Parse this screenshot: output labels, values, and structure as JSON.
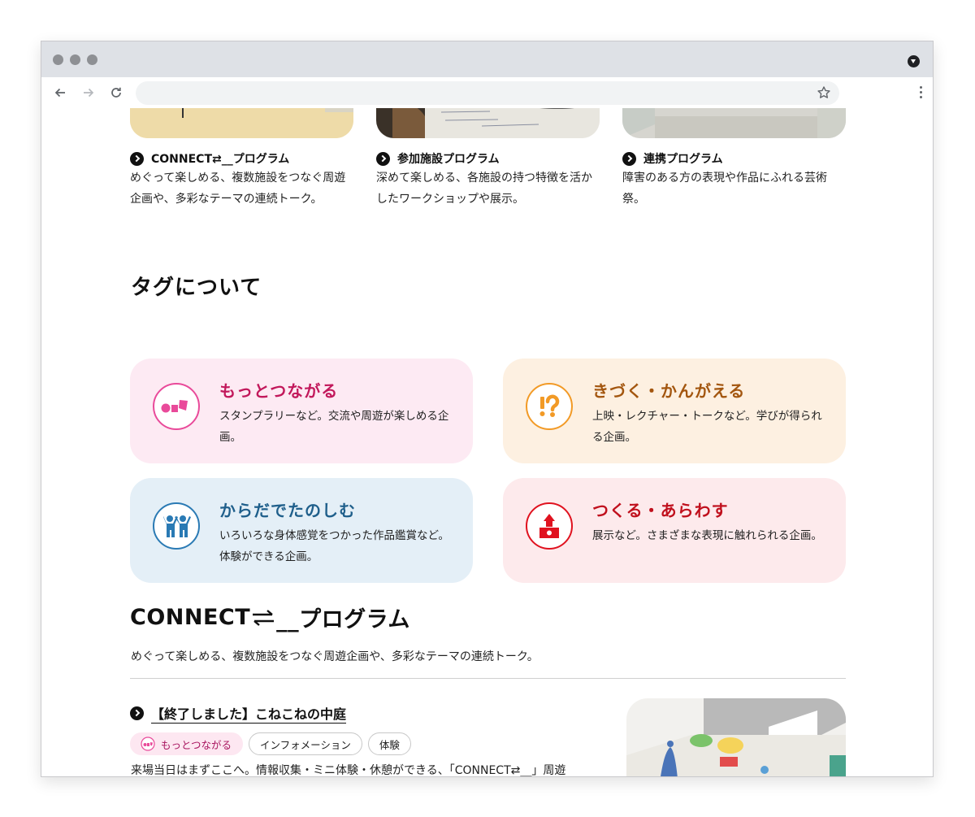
{
  "browser": {
    "url": ""
  },
  "programs": [
    {
      "title": "CONNECT⇄__プログラム",
      "desc": "めぐって楽しめる、複数施設をつなぐ周遊企画や、多彩なテーマの連続トーク。"
    },
    {
      "title": "参加施設プログラム",
      "desc": "深めて楽しめる、各施設の持つ特徴を活かしたワークショップや展示。"
    },
    {
      "title": "連携プログラム",
      "desc": "障害のある方の表現や作品にふれる芸術祭。"
    }
  ],
  "tags_section": {
    "heading": "タグについて",
    "tags": [
      {
        "name": "もっとつながる",
        "desc": "スタンプラリーなど。交流や周遊が楽しめる企画。",
        "color": "#c2185b",
        "bg": "#fdeaf3",
        "icon": "shapes-icon"
      },
      {
        "name": "きづく・かんがえる",
        "desc": "上映・レクチャー・トークなど。学びが得られる企画。",
        "color": "#a3560f",
        "bg": "#fdf0e1",
        "icon": "exclamation-question-icon"
      },
      {
        "name": "からだでたのしむ",
        "desc": "いろいろな身体感覚をつかった作品鑑賞など。体験ができる企画。",
        "color": "#1f5f8b",
        "bg": "#e4eff7",
        "icon": "people-icon"
      },
      {
        "name": "つくる・あらわす",
        "desc": "展示など。さまざまな表現に触れられる企画。",
        "color": "#c0101d",
        "bg": "#fdeaec",
        "icon": "blocks-icon"
      }
    ]
  },
  "connect_section": {
    "heading_prefix": "CONNECT",
    "heading_suffix": "__プログラム",
    "desc": "めぐって楽しめる、複数施設をつなぐ周遊企画や、多彩なテーマの連続トーク。",
    "event": {
      "title": "【終了しました】こねこねの中庭",
      "chips": [
        "もっとつながる",
        "インフォメーション",
        "体験"
      ],
      "desc": "来場当日はまずここへ。情報収集・ミニ体験・休憩ができる、「CONNECT⇄__」周遊"
    }
  }
}
